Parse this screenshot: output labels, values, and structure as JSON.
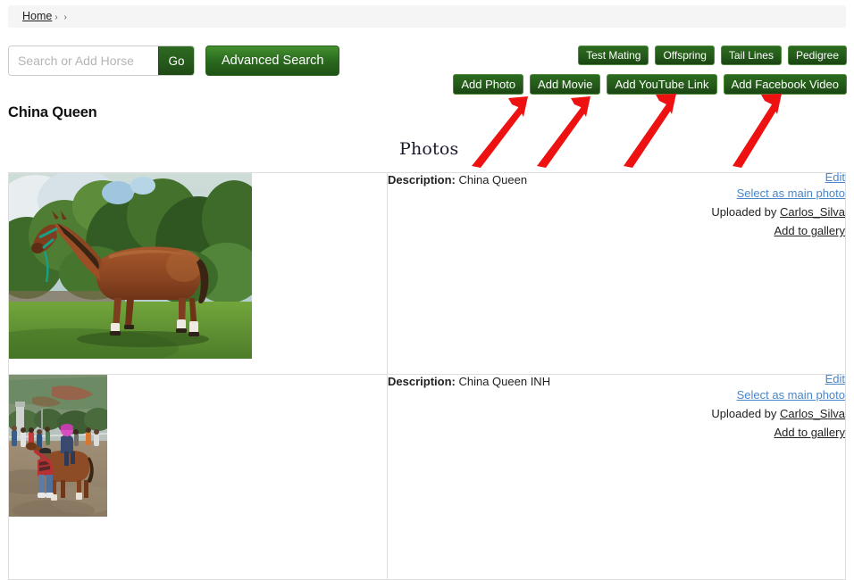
{
  "breadcrumb": {
    "home_label": "Home",
    "separators": "› ›"
  },
  "search": {
    "placeholder": "Search or Add Horse",
    "value": "",
    "go_label": "Go",
    "advanced_label": "Advanced Search"
  },
  "header": {
    "title": "China Queen"
  },
  "nav_buttons": [
    {
      "label": "Test Mating",
      "name": "test-mating-button"
    },
    {
      "label": "Offspring",
      "name": "offspring-button"
    },
    {
      "label": "Tail Lines",
      "name": "tail-lines-button"
    },
    {
      "label": "Pedigree",
      "name": "pedigree-button"
    }
  ],
  "action_buttons": [
    {
      "label": "Add Photo",
      "name": "add-photo-button"
    },
    {
      "label": "Add Movie",
      "name": "add-movie-button"
    },
    {
      "label": "Add YouTube Link",
      "name": "add-youtube-link-button"
    },
    {
      "label": "Add Facebook Video",
      "name": "add-facebook-video-button"
    }
  ],
  "section": {
    "photos_heading": "Photos"
  },
  "annotations": {
    "arrow_color": "#ee1111",
    "count": 4,
    "description": "Four red arrows pointing up-right at the four Add buttons"
  },
  "photos": [
    {
      "description_label": "Description:",
      "description_value": "China Queen",
      "edit_label": "Edit",
      "select_main_label": "Select as main photo",
      "uploaded_prefix": "Uploaded by",
      "uploader": "Carlos_Silva",
      "add_gallery_label": "Add to gallery",
      "image_alt": "Bay horse standing in profile on green grass with trees behind"
    },
    {
      "description_label": "Description:",
      "description_value": "China Queen INH",
      "edit_label": "Edit",
      "select_main_label": "Select as main photo",
      "uploaded_prefix": "Uploaded by",
      "uploader": "Carlos_Silva",
      "add_gallery_label": "Add to gallery",
      "image_alt": "Racehorse with jockey in pink helmet being led on a dirt track with hills behind"
    }
  ],
  "colors": {
    "button_green": "#245a1a",
    "link_blue": "#4a86c8",
    "breadcrumb_bg": "#f5f5f5",
    "table_border": "#dddddd"
  }
}
